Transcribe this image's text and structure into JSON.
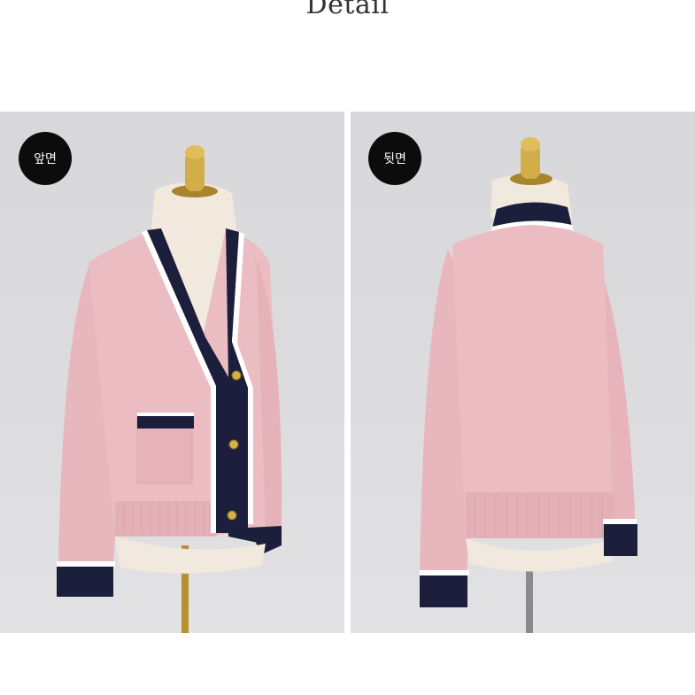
{
  "header": {
    "title": "Detail"
  },
  "panels": [
    {
      "label": "앞면",
      "view": "front"
    },
    {
      "label": "뒷면",
      "view": "back"
    }
  ],
  "colors": {
    "knit_pink": "#e9b9bf",
    "trim_navy": "#1b1f3a",
    "trim_white": "#ffffff",
    "gold": "#c9a23a",
    "mannequin": "#efe6dc"
  }
}
